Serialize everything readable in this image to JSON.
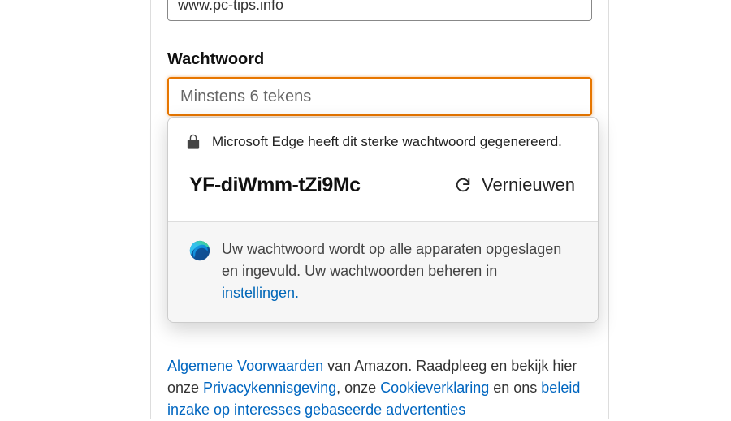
{
  "form": {
    "website_value": "www.pc-tips.info",
    "password_label": "Wachtwoord",
    "password_placeholder": "Minstens 6 tekens"
  },
  "popup": {
    "header_text": "Microsoft Edge heeft dit sterke wachtwoord gegenereerd.",
    "generated_password": "YF-diWmm-tZi9Mc",
    "refresh_label": "Vernieuwen",
    "footer_text_1": "Uw wachtwoord wordt op alle apparaten opgeslagen en ingevuld. Uw wachtwoorden beheren in ",
    "settings_link": "instellingen."
  },
  "terms": {
    "link1": "Algemene Voorwaarden",
    "text1": " van Amazon. Raadpleeg en bekijk hier onze ",
    "link2": "Privacykennisgeving",
    "text2": ", onze ",
    "link3": "Cookieverklaring",
    "text3": " en ons ",
    "link4": "beleid inzake op interesses gebaseerde advertenties"
  }
}
